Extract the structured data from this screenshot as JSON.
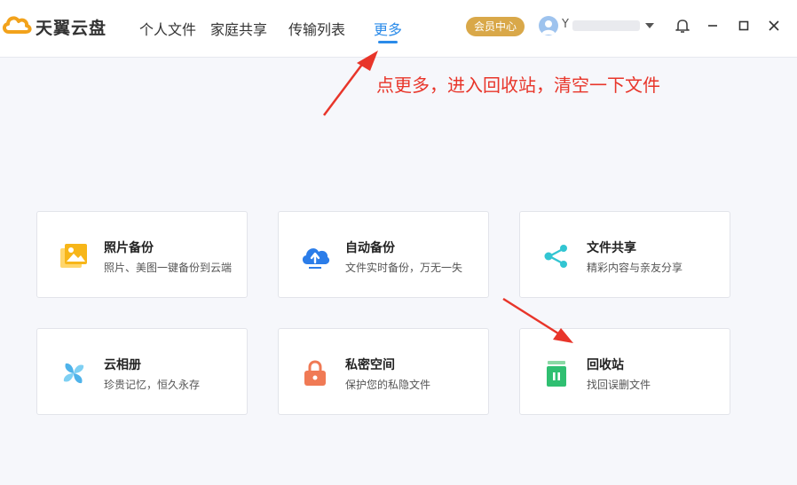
{
  "app": {
    "name": "天翼云盘"
  },
  "nav": {
    "items": [
      "个人文件",
      "家庭共享",
      "传输列表",
      "更多"
    ],
    "active_index": 3
  },
  "header": {
    "vip_label": "会员中心",
    "user_name": "Y"
  },
  "annotation": {
    "text": "点更多，进入回收站，清空一下文件",
    "color": "#e8352a"
  },
  "cards": [
    {
      "title": "照片备份",
      "desc": "照片、美图一键备份到云端",
      "icon": "photo-icon"
    },
    {
      "title": "自动备份",
      "desc": "文件实时备份，万无一失",
      "icon": "cloud-upload-icon"
    },
    {
      "title": "文件共享",
      "desc": "精彩内容与亲友分享",
      "icon": "share-icon"
    },
    {
      "title": "云相册",
      "desc": "珍贵记忆，恒久永存",
      "icon": "pinwheel-icon"
    },
    {
      "title": "私密空间",
      "desc": "保护您的私隐文件",
      "icon": "lock-icon"
    },
    {
      "title": "回收站",
      "desc": "找回误删文件",
      "icon": "trash-icon"
    }
  ],
  "colors": {
    "accent": "#2b8be9",
    "vip": "#d9a849",
    "annotation": "#e8352a"
  }
}
